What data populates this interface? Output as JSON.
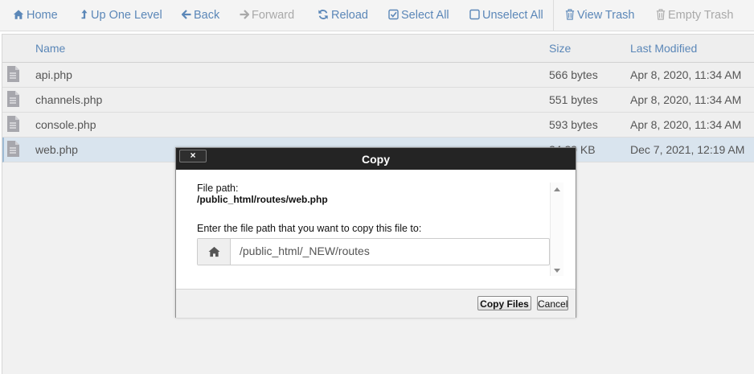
{
  "toolbar": {
    "home": "Home",
    "up_one_level": "Up One Level",
    "back": "Back",
    "forward": "Forward",
    "reload": "Reload",
    "select_all": "Select All",
    "unselect_all": "Unselect All",
    "view_trash": "View Trash",
    "empty_trash": "Empty Trash"
  },
  "table": {
    "columns": {
      "name": "Name",
      "size": "Size",
      "modified": "Last Modified"
    },
    "rows": [
      {
        "name": "api.php",
        "size": "566 bytes",
        "modified": "Apr 8, 2020, 11:34 AM"
      },
      {
        "name": "channels.php",
        "size": "551 bytes",
        "modified": "Apr 8, 2020, 11:34 AM"
      },
      {
        "name": "console.php",
        "size": "593 bytes",
        "modified": "Apr 8, 2020, 11:34 AM"
      },
      {
        "name": "web.php",
        "size": "24.39 KB",
        "modified": "Dec 7, 2021, 12:19 AM",
        "selected": true
      }
    ]
  },
  "dialog": {
    "title": "Copy",
    "close_label": "×",
    "file_path_label": "File path:",
    "file_path_value": "/public_html/routes/web.php",
    "destination_label": "Enter the file path that you want to copy this file to:",
    "destination_value": "/public_html/_NEW/routes",
    "copy_button": "Copy Files",
    "cancel_button": "Cancel"
  },
  "icons": {
    "home": "home-icon",
    "up": "level-up-icon",
    "back": "arrow-left-icon",
    "forward": "arrow-right-icon",
    "reload": "refresh-icon",
    "select_all": "checkbox-checked-icon",
    "unselect_all": "checkbox-empty-icon",
    "trash": "trash-icon",
    "file": "file-text-icon"
  },
  "colors": {
    "link_blue": "#5b87b8",
    "disabled_gray": "#a9a9a9",
    "dialog_header": "#242424",
    "selected_row": "#d9e4ee"
  }
}
